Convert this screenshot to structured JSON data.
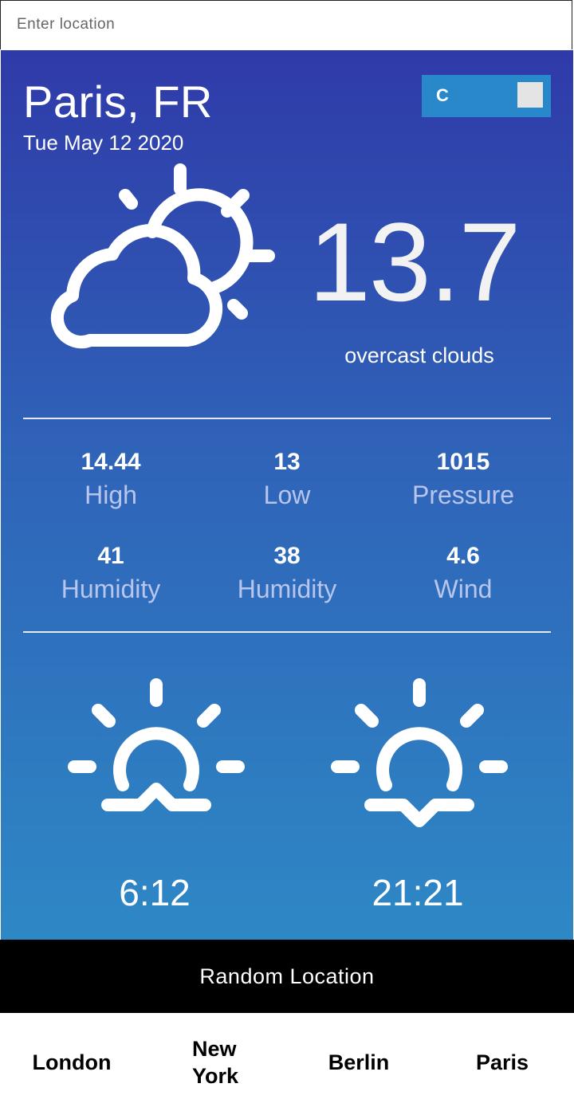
{
  "search": {
    "placeholder": "Enter location",
    "value": ""
  },
  "weather": {
    "city": "Paris, FR",
    "date": "Tue May 12 2020",
    "temperature": "13.7",
    "description": "overcast clouds",
    "unit_toggle": {
      "label": "C"
    }
  },
  "stats": [
    {
      "value": "14.44",
      "label": "High"
    },
    {
      "value": "13",
      "label": "Low"
    },
    {
      "value": "1015",
      "label": "Pressure"
    },
    {
      "value": "41",
      "label": "Humidity"
    },
    {
      "value": "38",
      "label": "Humidity"
    },
    {
      "value": "4.6",
      "label": "Wind"
    }
  ],
  "sun": {
    "sunrise": "6:12",
    "sunset": "21:21"
  },
  "random_button": "Random Location",
  "cities": [
    "London",
    "New\nYork",
    "Berlin",
    "Paris"
  ],
  "icons": {
    "condition": "cloud-sun-icon",
    "sunrise": "sunrise-icon",
    "sunset": "sunset-icon"
  },
  "colors": {
    "panel_top": "#2f3aa9",
    "panel_bottom": "#2e88c5",
    "toggle": "#2988c9",
    "button": "#000000"
  }
}
